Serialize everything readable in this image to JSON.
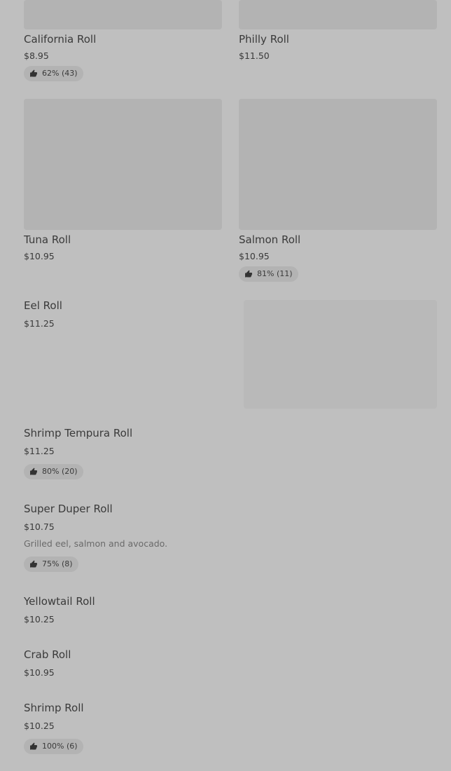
{
  "items": [
    {
      "name": "California Roll",
      "price": "$8.95",
      "rating": "62% (43)",
      "icon": "thumbs-up-icon"
    },
    {
      "name": "Philly Roll",
      "price": "$11.50"
    },
    {
      "name": "Tuna Roll",
      "price": "$10.95"
    },
    {
      "name": "Salmon Roll",
      "price": "$10.95",
      "rating": "81% (11)",
      "icon": "thumbs-up-icon"
    },
    {
      "name": "Eel Roll",
      "price": "$11.25"
    },
    {
      "name": "Shrimp Tempura Roll",
      "price": "$11.25",
      "rating": "80% (20)",
      "icon": "thumbs-up-icon"
    },
    {
      "name": "Super Duper Roll",
      "price": "$10.75",
      "description": "Grilled eel, salmon and avocado.",
      "rating": "75% (8)",
      "icon": "thumbs-up-icon"
    },
    {
      "name": "Yellowtail Roll",
      "price": "$10.25"
    },
    {
      "name": "Crab Roll",
      "price": "$10.95"
    },
    {
      "name": "Shrimp Roll",
      "price": "$10.25",
      "rating": "100% (6)",
      "icon": "thumbs-up-icon"
    }
  ]
}
